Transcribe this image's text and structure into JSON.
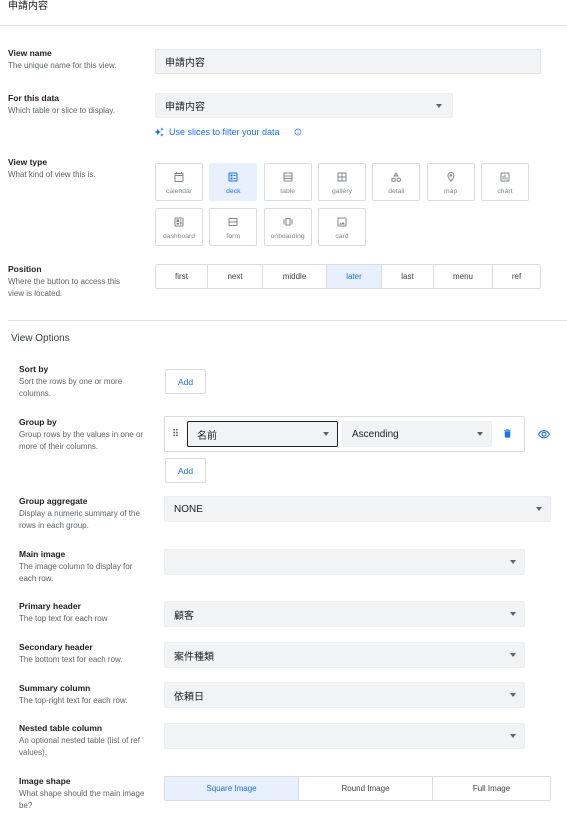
{
  "page_title": "申請内容",
  "colors": {
    "accent": "#1a73e8",
    "selected_bg": "#e8f0fe",
    "field_bg": "#f1f3f4",
    "help_text": "#5f6368"
  },
  "view_name": {
    "label": "View name",
    "help": "The unique name for this view.",
    "value": "申請内容"
  },
  "for_this_data": {
    "label": "For this data",
    "help": "Which table or slice to display.",
    "value": "申請内容",
    "slices_link": "Use slices to filter your data",
    "slices_icon": "sparkle-icon",
    "info_icon": "info-icon"
  },
  "view_type": {
    "label": "View type",
    "help": "What kind of view this is.",
    "selected": "deck",
    "options": [
      {
        "label": "calendar",
        "icon": "calendar-icon"
      },
      {
        "label": "deck",
        "icon": "deck-icon"
      },
      {
        "label": "table",
        "icon": "table-icon"
      },
      {
        "label": "gallery",
        "icon": "gallery-icon"
      },
      {
        "label": "detail",
        "icon": "detail-icon"
      },
      {
        "label": "map",
        "icon": "map-icon"
      },
      {
        "label": "chart",
        "icon": "chart-icon"
      },
      {
        "label": "dashboard",
        "icon": "dashboard-icon"
      },
      {
        "label": "form",
        "icon": "form-icon"
      },
      {
        "label": "onboarding",
        "icon": "onboarding-icon"
      },
      {
        "label": "card",
        "icon": "card-icon"
      }
    ]
  },
  "position": {
    "label": "Position",
    "help": "Where the button to access this view is located.",
    "selected": "later",
    "options": [
      "first",
      "next",
      "middle",
      "later",
      "last",
      "menu",
      "ref"
    ]
  },
  "view_options": {
    "heading": "View Options",
    "sort_by": {
      "label": "Sort by",
      "help": "Sort the rows by one or more columns.",
      "add_label": "Add"
    },
    "group_by": {
      "label": "Group by",
      "help": "Group rows by the values in one or more of their columns.",
      "column": "名前",
      "order": "Ascending",
      "add_label": "Add"
    },
    "group_aggregate": {
      "label": "Group aggregate",
      "help": "Display a numeric summary of the rows in each group.",
      "value": "NONE"
    },
    "main_image": {
      "label": "Main image",
      "help": "The image column to display for each row.",
      "value": ""
    },
    "primary_header": {
      "label": "Primary header",
      "help": "The top text for each row",
      "value": "顧客"
    },
    "secondary_header": {
      "label": "Secondary header",
      "help": "The bottom text for each row.",
      "value": "案件種類"
    },
    "summary_column": {
      "label": "Summary column",
      "help": "The top-right text for each row.",
      "value": "依頼日"
    },
    "nested_table_column": {
      "label": "Nested table column",
      "help": "An optional nested table (list of ref values).",
      "value": ""
    },
    "image_shape": {
      "label": "Image shape",
      "help": "What shape should the main image be?",
      "selected": "Square Image",
      "options": [
        "Square Image",
        "Round Image",
        "Full Image"
      ]
    }
  }
}
